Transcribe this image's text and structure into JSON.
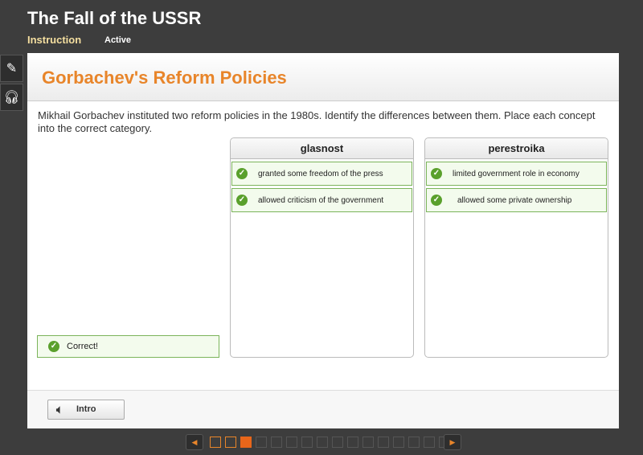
{
  "header": {
    "title": "The Fall of the USSR",
    "tabs": [
      {
        "label": "Instruction",
        "color": "#f5dfa0"
      },
      {
        "label": "Active",
        "color": "#ffffff"
      }
    ]
  },
  "sidebar": {
    "tools": [
      {
        "icon": "pencil-icon"
      },
      {
        "icon": "headphones-icon"
      }
    ]
  },
  "activity": {
    "title": "Gorbachev's Reform Policies",
    "instructions": "Mikhail Gorbachev instituted two reform policies in the 1980s. Identify the differences between them. Place each concept into the correct category.",
    "columns": [
      {
        "label": "glasnost",
        "items": [
          "granted some freedom of the press",
          "allowed criticism of the government"
        ]
      },
      {
        "label": "perestroika",
        "items": [
          "limited government role in economy",
          "allowed some private ownership"
        ]
      }
    ],
    "feedback": "Correct!"
  },
  "footer": {
    "intro_label": "Intro"
  },
  "pagination": {
    "total": 16,
    "current": 3,
    "visited": [
      1,
      2
    ]
  },
  "colors": {
    "accent": "#e8852a",
    "correct": "#5aa02c"
  }
}
